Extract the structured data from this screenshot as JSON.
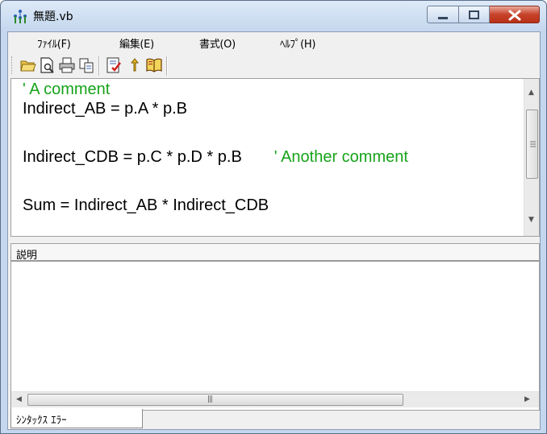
{
  "window": {
    "title": "無題.vb"
  },
  "menu": {
    "items": [
      {
        "label": "ﾌｧｲﾙ(F)"
      },
      {
        "label": "編集(E)"
      },
      {
        "label": "書式(O)"
      },
      {
        "label": "ﾍﾙﾌﾟ(H)"
      }
    ]
  },
  "toolbar": {
    "buttons": [
      "open-icon",
      "print-preview-icon",
      "print-icon",
      "copy-icon",
      "check-icon",
      "arrow-up-icon",
      "help-book-icon"
    ]
  },
  "editor": {
    "lines": {
      "l1": {
        "code": "",
        "comment": "' A comment"
      },
      "l2": {
        "code": "Indirect_AB = p.A * p.B",
        "comment": ""
      },
      "l3": {
        "code": "Indirect_CDB = p.C * p.D * p.B",
        "comment": "' Another comment"
      },
      "l4": {
        "code": "Sum = Indirect_AB * Indirect_CDB",
        "comment": ""
      }
    },
    "comment_color": "#17a31a"
  },
  "errors": {
    "column_header": "説明"
  },
  "tabs": {
    "syntax_errors": "ｼﾝﾀｯｸｽ ｴﾗｰ"
  }
}
